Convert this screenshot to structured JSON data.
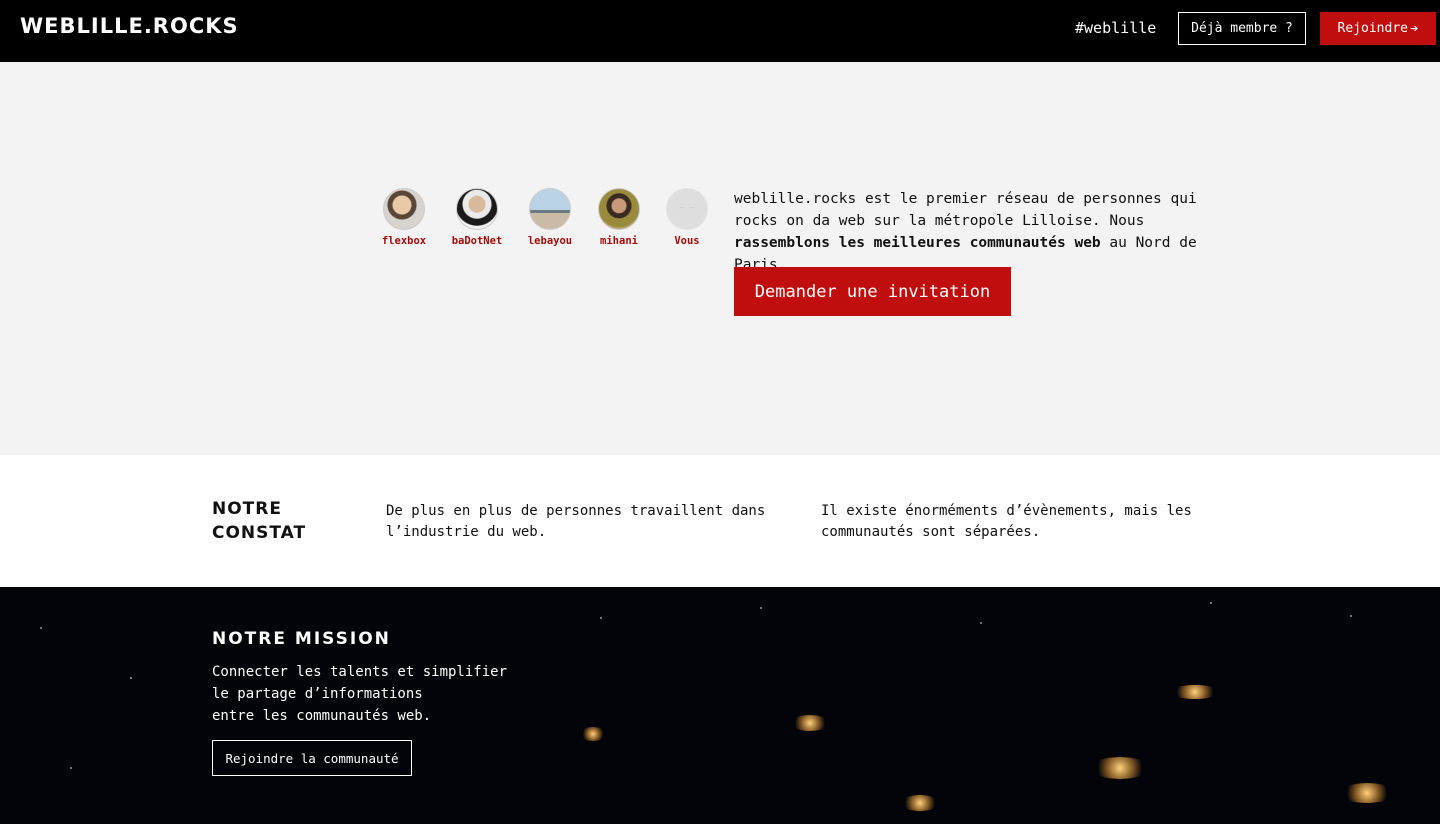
{
  "header": {
    "logo": "WEBLILLE.ROCKS",
    "hashtag": "#weblille",
    "member_button": "Déjà membre ?",
    "join_button": "Rejoindre"
  },
  "hero": {
    "members": [
      {
        "name": "flexbox"
      },
      {
        "name": "baDotNet"
      },
      {
        "name": "lebayou"
      },
      {
        "name": "mihani"
      },
      {
        "name": "Vous"
      }
    ],
    "intro_part1": "weblille.rocks est le premier réseau de personnes qui rocks on da web sur la métropole Lilloise. Nous ",
    "intro_bold": "rassemblons les meilleures communautés web",
    "intro_part2": " au Nord de Paris.",
    "invite_button": "Demander une invitation"
  },
  "constat": {
    "title": "NOTRE CONSTAT",
    "point1": "De plus en plus de personnes travaillent dans l’industrie du web.",
    "point2": "Il existe énorméments d’évènements, mais les communautés sont séparées."
  },
  "mission": {
    "title": "NOTRE MISSION",
    "line1": "Connecter les talents et simplifier",
    "line2": "le partage d’informations",
    "line3": "entre les communautés web.",
    "button": "Rejoindre la communauté"
  },
  "colors": {
    "brand_red": "#c00d0d",
    "header_bg": "#000000",
    "hero_bg": "#f3f3f3"
  }
}
